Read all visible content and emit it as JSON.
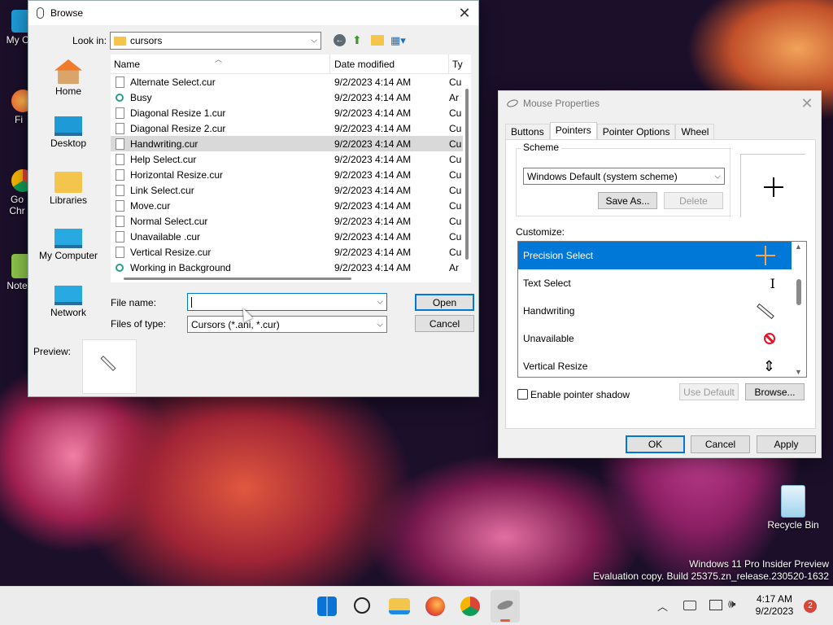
{
  "desktop": {
    "icons_left": [
      "My Co",
      "Fi",
      "Go\nChr",
      "Note"
    ],
    "recycle_bin": "Recycle Bin",
    "watermark_line1": "Windows 11 Pro Insider Preview",
    "watermark_line2": "Evaluation copy. Build 25375.zn_release.230520-1632"
  },
  "browse": {
    "title": "Browse",
    "look_in_label": "Look in:",
    "look_in_value": "cursors",
    "places": [
      "Home",
      "Desktop",
      "Libraries",
      "My Computer",
      "Network"
    ],
    "columns": [
      "Name",
      "Date modified",
      "Ty"
    ],
    "files": [
      {
        "name": "Alternate Select.cur",
        "date": "9/2/2023 4:14 AM",
        "type": "Cu"
      },
      {
        "name": "Busy",
        "date": "9/2/2023 4:14 AM",
        "type": "Ar"
      },
      {
        "name": "Diagonal Resize 1.cur",
        "date": "9/2/2023 4:14 AM",
        "type": "Cu"
      },
      {
        "name": "Diagonal Resize 2.cur",
        "date": "9/2/2023 4:14 AM",
        "type": "Cu"
      },
      {
        "name": "Handwriting.cur",
        "date": "9/2/2023 4:14 AM",
        "type": "Cu"
      },
      {
        "name": "Help Select.cur",
        "date": "9/2/2023 4:14 AM",
        "type": "Cu"
      },
      {
        "name": "Horizontal Resize.cur",
        "date": "9/2/2023 4:14 AM",
        "type": "Cu"
      },
      {
        "name": "Link Select.cur",
        "date": "9/2/2023 4:14 AM",
        "type": "Cu"
      },
      {
        "name": "Move.cur",
        "date": "9/2/2023 4:14 AM",
        "type": "Cu"
      },
      {
        "name": "Normal Select.cur",
        "date": "9/2/2023 4:14 AM",
        "type": "Cu"
      },
      {
        "name": "Unavailable .cur",
        "date": "9/2/2023 4:14 AM",
        "type": "Cu"
      },
      {
        "name": "Vertical Resize.cur",
        "date": "9/2/2023 4:14 AM",
        "type": "Cu"
      },
      {
        "name": "Working in Background",
        "date": "9/2/2023 4:14 AM",
        "type": "Ar"
      }
    ],
    "selected_file_index": 4,
    "file_name_label": "File name:",
    "file_name_value": "",
    "files_of_type_label": "Files of type:",
    "files_of_type_value": "Cursors (*.ani, *.cur)",
    "open_label": "Open",
    "cancel_label": "Cancel",
    "preview_label": "Preview:"
  },
  "mouse": {
    "title": "Mouse Properties",
    "tabs": [
      "Buttons",
      "Pointers",
      "Pointer Options",
      "Wheel"
    ],
    "active_tab": "Pointers",
    "scheme_label": "Scheme",
    "scheme_value": "Windows Default (system scheme)",
    "save_as_label": "Save As...",
    "delete_label": "Delete",
    "customize_label": "Customize:",
    "cursors": [
      {
        "name": "Precision Select",
        "icon": "crosshair-icon"
      },
      {
        "name": "Text Select",
        "icon": "ibeam-icon"
      },
      {
        "name": "Handwriting",
        "icon": "pen-icon"
      },
      {
        "name": "Unavailable",
        "icon": "unavailable-icon"
      },
      {
        "name": "Vertical Resize",
        "icon": "vertical-resize-icon"
      }
    ],
    "enable_shadow_label": "Enable pointer shadow",
    "enable_shadow_checked": false,
    "use_default_label": "Use Default",
    "browse_label": "Browse...",
    "ok_label": "OK",
    "cancel_label": "Cancel",
    "apply_label": "Apply"
  },
  "taskbar": {
    "time": "4:17 AM",
    "date": "9/2/2023",
    "notification_count": "2"
  },
  "colors": {
    "accent": "#0078d7",
    "unavailable_red": "#e81123",
    "crosshair_orange": "#f7a44a"
  }
}
